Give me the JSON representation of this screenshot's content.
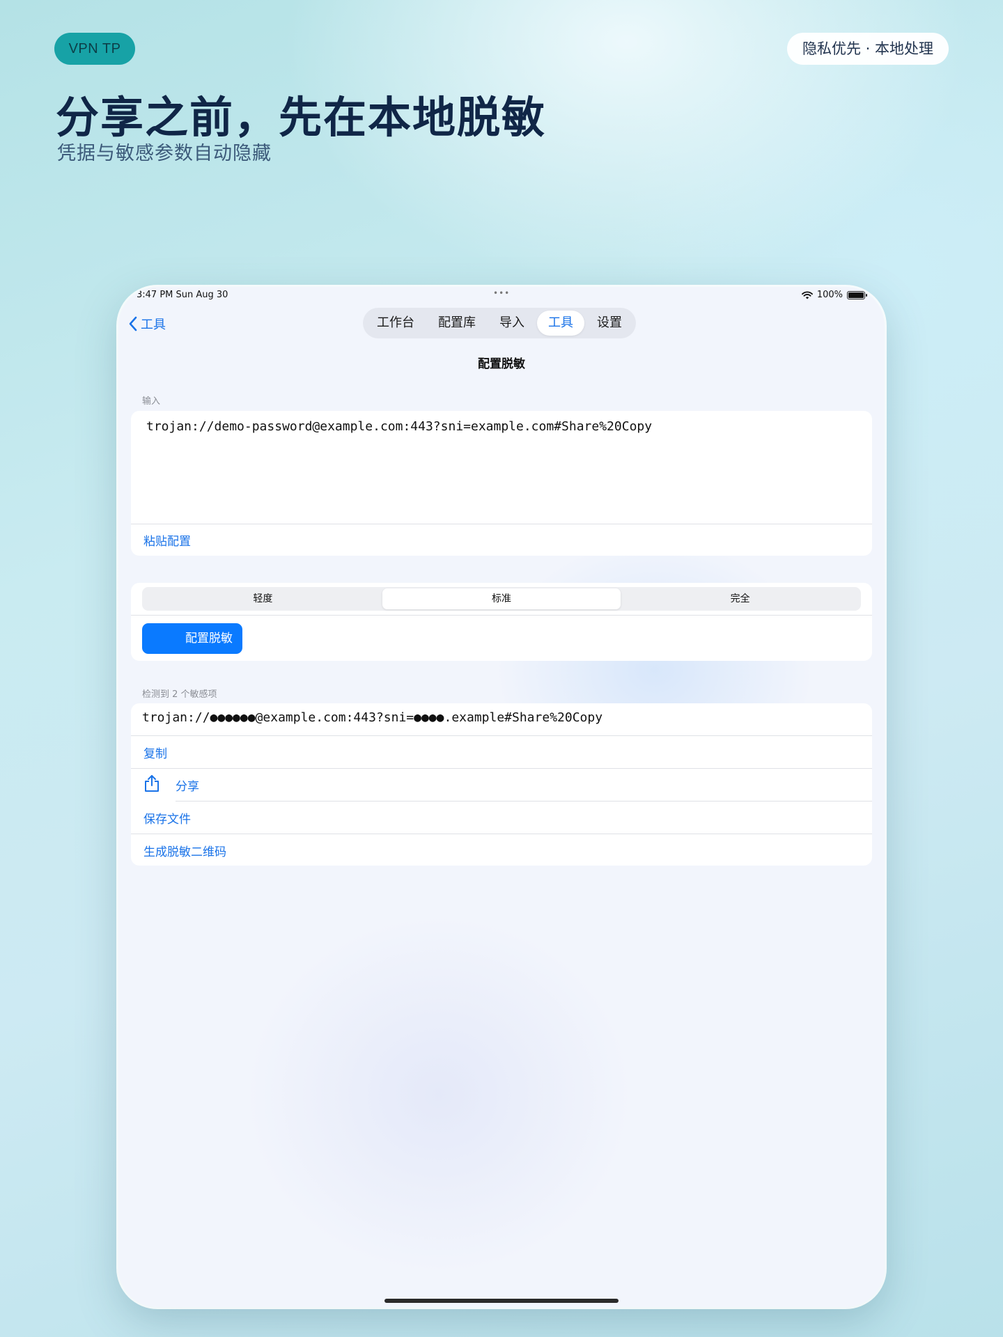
{
  "header": {
    "brand": "VPN TP",
    "privacy_tag": "隐私优先 · 本地处理",
    "title": "分享之前，先在本地脱敏",
    "subtitle": "凭据与敏感参数自动隐藏"
  },
  "status_bar": {
    "time": "3:47 PM   Sun Aug 30",
    "dots": "•••",
    "battery": "100%",
    "battery_level": 1.0
  },
  "nav": {
    "back_label": "工具",
    "tabs": [
      {
        "label": "工作台",
        "active": false
      },
      {
        "label": "配置库",
        "active": false
      },
      {
        "label": "导入",
        "active": false
      },
      {
        "label": "工具",
        "active": true
      },
      {
        "label": "设置",
        "active": false
      }
    ]
  },
  "page": {
    "title": "配置脱敏"
  },
  "input_section": {
    "label": "输入",
    "value": "trojan://demo-password@example.com:443?sni=example.com#Share%20Copy",
    "paste_label": "粘贴配置"
  },
  "level_section": {
    "segments": [
      {
        "label": "轻度",
        "active": false
      },
      {
        "label": "标准",
        "active": true
      },
      {
        "label": "完全",
        "active": false
      }
    ],
    "action_label": "配置脱敏"
  },
  "result_section": {
    "label": "检测到 2 个敏感项",
    "value": "trojan://●●●●●●@example.com:443?sni=●●●●.example#Share%20Copy",
    "actions": {
      "copy": "复制",
      "share": "分享",
      "save": "保存文件",
      "qrcode": "生成脱敏二维码"
    }
  },
  "colors": {
    "accent": "#1a73e8",
    "primary_button": "#0a7aff",
    "brand_pill": "#17a2a6"
  }
}
